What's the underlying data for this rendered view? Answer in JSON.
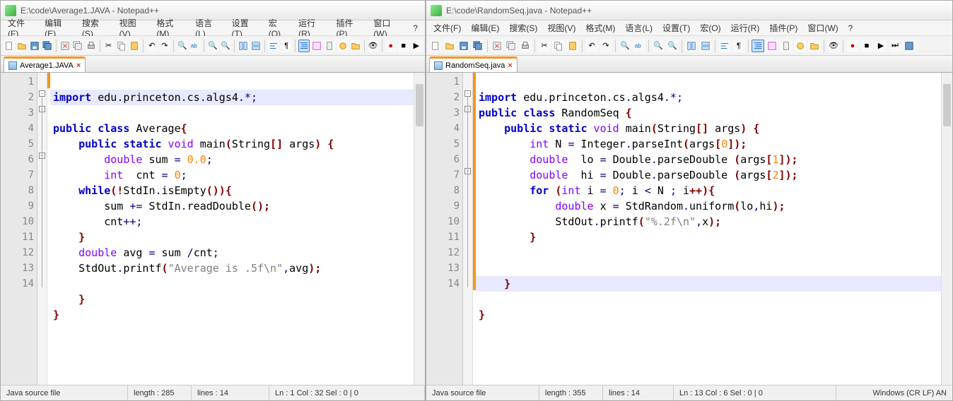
{
  "left": {
    "title": "E:\\code\\Average1.JAVA - Notepad++",
    "menu": [
      "文件(F)",
      "编辑(E)",
      "搜索(S)",
      "视图(V)",
      "格式(M)",
      "语言(L)",
      "设置(T)",
      "宏(O)",
      "运行(R)",
      "插件(P)",
      "窗口(W)",
      "?"
    ],
    "tab": "Average1.JAVA",
    "lines": [
      "1",
      "2",
      "3",
      "4",
      "5",
      "6",
      "7",
      "8",
      "9",
      "10",
      "11",
      "12",
      "13",
      "14"
    ],
    "code": {
      "l1a": "import",
      "l1b": " edu",
      "l1c": ".",
      "l1d": "princeton",
      "l1e": ".",
      "l1f": "cs",
      "l1g": ".",
      "l1h": "algs4",
      "l1i": ".*;",
      "l2a": "public",
      "l2b": " class",
      "l2c": " Average",
      "l2d": "{",
      "l3a": "    public",
      "l3b": " static",
      "l3c": " void",
      "l3d": " main",
      "l3e": "(",
      "l3f": "String",
      "l3g": "[]",
      "l3h": " args",
      "l3i": ")",
      "l3j": " {",
      "l4a": "        double",
      "l4b": " sum ",
      "l4c": "=",
      "l4d": " ",
      "l4e": "0.0",
      "l4f": ";",
      "l5a": "        int",
      "l5b": "  cnt ",
      "l5c": "=",
      "l5d": " ",
      "l5e": "0",
      "l5f": ";",
      "l6a": "    while",
      "l6b": "(!",
      "l6c": "StdIn",
      "l6d": ".",
      "l6e": "isEmpty",
      "l6f": "()){",
      "l7a": "        sum ",
      "l7b": "+=",
      "l7c": " StdIn",
      "l7d": ".",
      "l7e": "readDouble",
      "l7f": "();",
      "l8a": "        cnt",
      "l8b": "++;",
      "l9a": "    }",
      "l10a": "    double",
      "l10b": " avg ",
      "l10c": "=",
      "l10d": " sum ",
      "l10e": "/",
      "l10f": "cnt",
      "l10g": ";",
      "l11a": "    StdOut",
      "l11b": ".",
      "l11c": "printf",
      "l11d": "(",
      "l11e": "\"Average is .5f\\n\"",
      "l11f": ",",
      "l11g": "avg",
      "l11h": ");",
      "l12": "",
      "l13a": "    }",
      "l14a": "}"
    },
    "status": {
      "type": "Java source file",
      "length": "length : 285",
      "lines": "lines : 14",
      "pos": "Ln : 1    Col : 32    Sel : 0 | 0"
    }
  },
  "right": {
    "title": "E:\\code\\RandomSeq.java - Notepad++",
    "menu": [
      "文件(F)",
      "编辑(E)",
      "搜索(S)",
      "视图(V)",
      "格式(M)",
      "语言(L)",
      "设置(T)",
      "宏(O)",
      "运行(R)",
      "插件(P)",
      "窗口(W)",
      "?"
    ],
    "tab": "RandomSeq.java",
    "lines": [
      "1",
      "2",
      "3",
      "4",
      "5",
      "6",
      "7",
      "8",
      "9",
      "10",
      "11",
      "12",
      "13",
      "14"
    ],
    "code": {
      "l1a": "import",
      "l1b": " edu",
      "l1c": ".",
      "l1d": "princeton",
      "l1e": ".",
      "l1f": "cs",
      "l1g": ".",
      "l1h": "algs4",
      "l1i": ".*;",
      "l2a": "public",
      "l2b": " class",
      "l2c": " RandomSeq ",
      "l2d": "{",
      "l3a": "    public",
      "l3b": " static",
      "l3c": " void",
      "l3d": " main",
      "l3e": "(",
      "l3f": "String",
      "l3g": "[]",
      "l3h": " args",
      "l3i": ")",
      "l3j": " {",
      "l4a": "        int",
      "l4b": " N ",
      "l4c": "=",
      "l4d": " Integer",
      "l4e": ".",
      "l4f": "parseInt",
      "l4g": "(",
      "l4h": "args",
      "l4i": "[",
      "l4j": "0",
      "l4k": "]);",
      "l5a": "        double",
      "l5b": "  lo ",
      "l5c": "=",
      "l5d": " Double",
      "l5e": ".",
      "l5f": "parseDouble ",
      "l5g": "(",
      "l5h": "args",
      "l5i": "[",
      "l5j": "1",
      "l5k": "]);",
      "l6a": "        double",
      "l6b": "  hi ",
      "l6c": "=",
      "l6d": " Double",
      "l6e": ".",
      "l6f": "parseDouble ",
      "l6g": "(",
      "l6h": "args",
      "l6i": "[",
      "l6j": "2",
      "l6k": "]);",
      "l7a": "        for",
      "l7b": " (",
      "l7c": "int",
      "l7d": " i ",
      "l7e": "=",
      "l7f": " ",
      "l7g": "0",
      "l7h": ";",
      "l7i": " i ",
      "l7j": "<",
      "l7k": " N ",
      "l7l": ";",
      "l7m": " i",
      "l7n": "++){",
      "l8a": "            double",
      "l8b": " x ",
      "l8c": "=",
      "l8d": " StdRandom",
      "l8e": ".",
      "l8f": "uniform",
      "l8g": "(",
      "l8h": "lo",
      "l8i": ",",
      "l8j": "hi",
      "l8k": ");",
      "l9a": "            StdOut",
      "l9b": ".",
      "l9c": "printf",
      "l9d": "(",
      "l9e": "\"%.2f\\n\"",
      "l9f": ",",
      "l9g": "x",
      "l9h": ");",
      "l10a": "        }",
      "l11": "",
      "l12": "",
      "l13a": "    }",
      "l14a": "}"
    },
    "status": {
      "type": "Java source file",
      "length": "length : 355",
      "lines": "lines : 14",
      "pos": "Ln : 13    Col : 6    Sel : 0 | 0",
      "enc": "Windows (CR LF)    AN"
    }
  }
}
